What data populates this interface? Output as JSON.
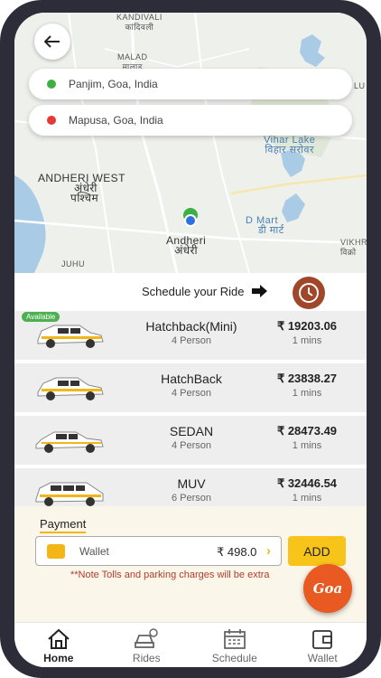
{
  "map": {
    "labels": {
      "kandivali": "KANDIVALI",
      "kandivali_hi": "कांदिवली",
      "malad": "MALAD",
      "malad_hi": "मालाड",
      "lu": "LU",
      "vihar_lake": "Vihar Lake",
      "vihar_lake_hi": "विहार सरोवर",
      "andheri_west": "ANDHERI WEST",
      "andheri_west_hi1": "अंधेरी",
      "andheri_west_hi2": "पश्चिम",
      "dmart": "D Mart",
      "dmart_hi": "डी मार्ट",
      "andheri": "Andheri",
      "andheri_hi": "अंधेरी",
      "vikhr": "VIKHR",
      "vikhr_hi": "विक्रो",
      "juhu": "JUHU"
    },
    "pickup": "Panjim, Goa, India",
    "drop": "Mapusa, Goa, India"
  },
  "schedule": {
    "label": "Schedule your Ride"
  },
  "vehicles": [
    {
      "name": "Hatchback(Mini)",
      "capacity": "4 Person",
      "price": "₹ 19203.06",
      "eta": "1 mins",
      "badge": "Available"
    },
    {
      "name": "HatchBack",
      "capacity": "4 Person",
      "price": "₹ 23838.27",
      "eta": "1 mins"
    },
    {
      "name": "SEDAN",
      "capacity": "4 Person",
      "price": "₹ 28473.49",
      "eta": "1 mins"
    },
    {
      "name": "MUV",
      "capacity": "6 Person",
      "price": "₹ 32446.54",
      "eta": "1 mins"
    }
  ],
  "payment": {
    "title": "Payment",
    "wallet_label": "Wallet",
    "wallet_amount": "₹ 498.0",
    "add_label": "ADD",
    "note": "**Note Tolls and parking charges will be extra"
  },
  "fab": {
    "text": "Goa"
  },
  "nav": [
    {
      "label": "Home",
      "icon": "home-icon"
    },
    {
      "label": "Rides",
      "icon": "car-icon"
    },
    {
      "label": "Schedule",
      "icon": "calendar-icon"
    },
    {
      "label": "Wallet",
      "icon": "wallet-icon"
    }
  ],
  "colors": {
    "accent": "#f8c41a",
    "pickup_dot": "#3cb043",
    "drop_dot": "#e53935",
    "available": "#4caf50",
    "note": "#b23c2a",
    "clock": "#a0472a"
  }
}
